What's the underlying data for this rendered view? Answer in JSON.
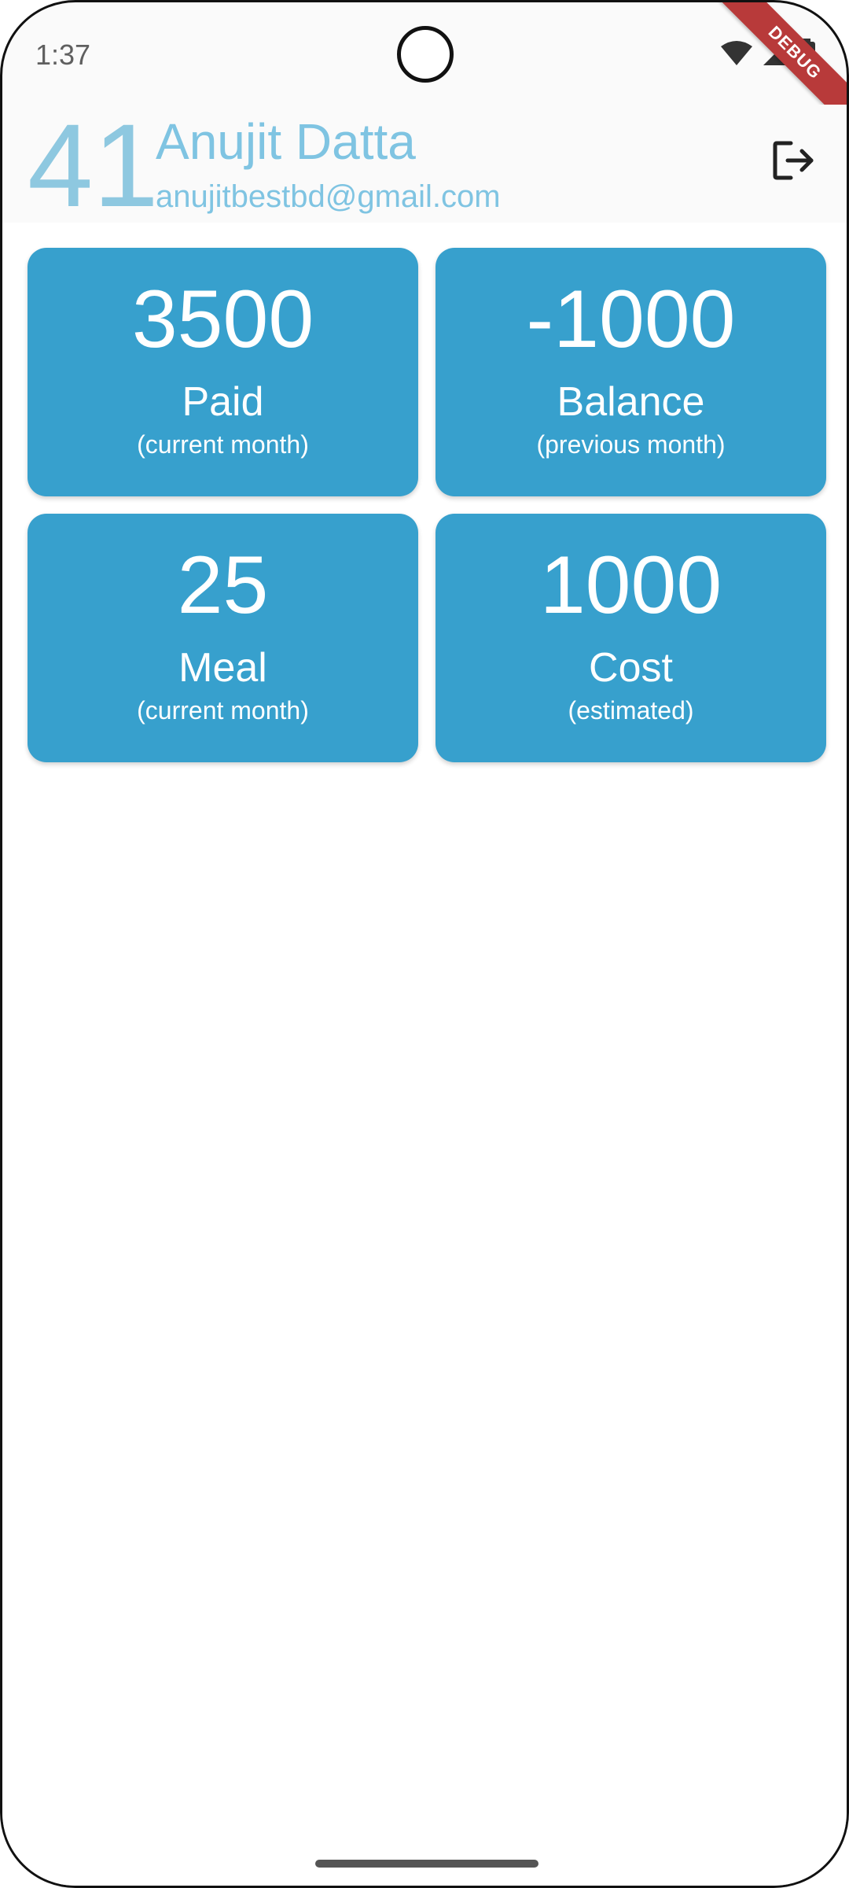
{
  "status_bar": {
    "time": "1:37",
    "icons": [
      "wifi-icon",
      "signal-icon",
      "battery-icon"
    ],
    "debug_banner": "DEBUG"
  },
  "header": {
    "number": "41",
    "name": "Anujit Datta",
    "email": "anujitbestbd@gmail.com",
    "logout_icon": "logout-icon"
  },
  "cards": [
    {
      "value": "3500",
      "label": "Paid",
      "sub": "(current month)"
    },
    {
      "value": "-1000",
      "label": "Balance",
      "sub": "(previous month)"
    },
    {
      "value": "25",
      "label": "Meal",
      "sub": "(current month)"
    },
    {
      "value": "1000",
      "label": "Cost",
      "sub": "(estimated)"
    }
  ],
  "colors": {
    "card_background": "#37a0cd",
    "header_accent": "#7fc4e2",
    "debug_ribbon": "#b83a3a"
  }
}
